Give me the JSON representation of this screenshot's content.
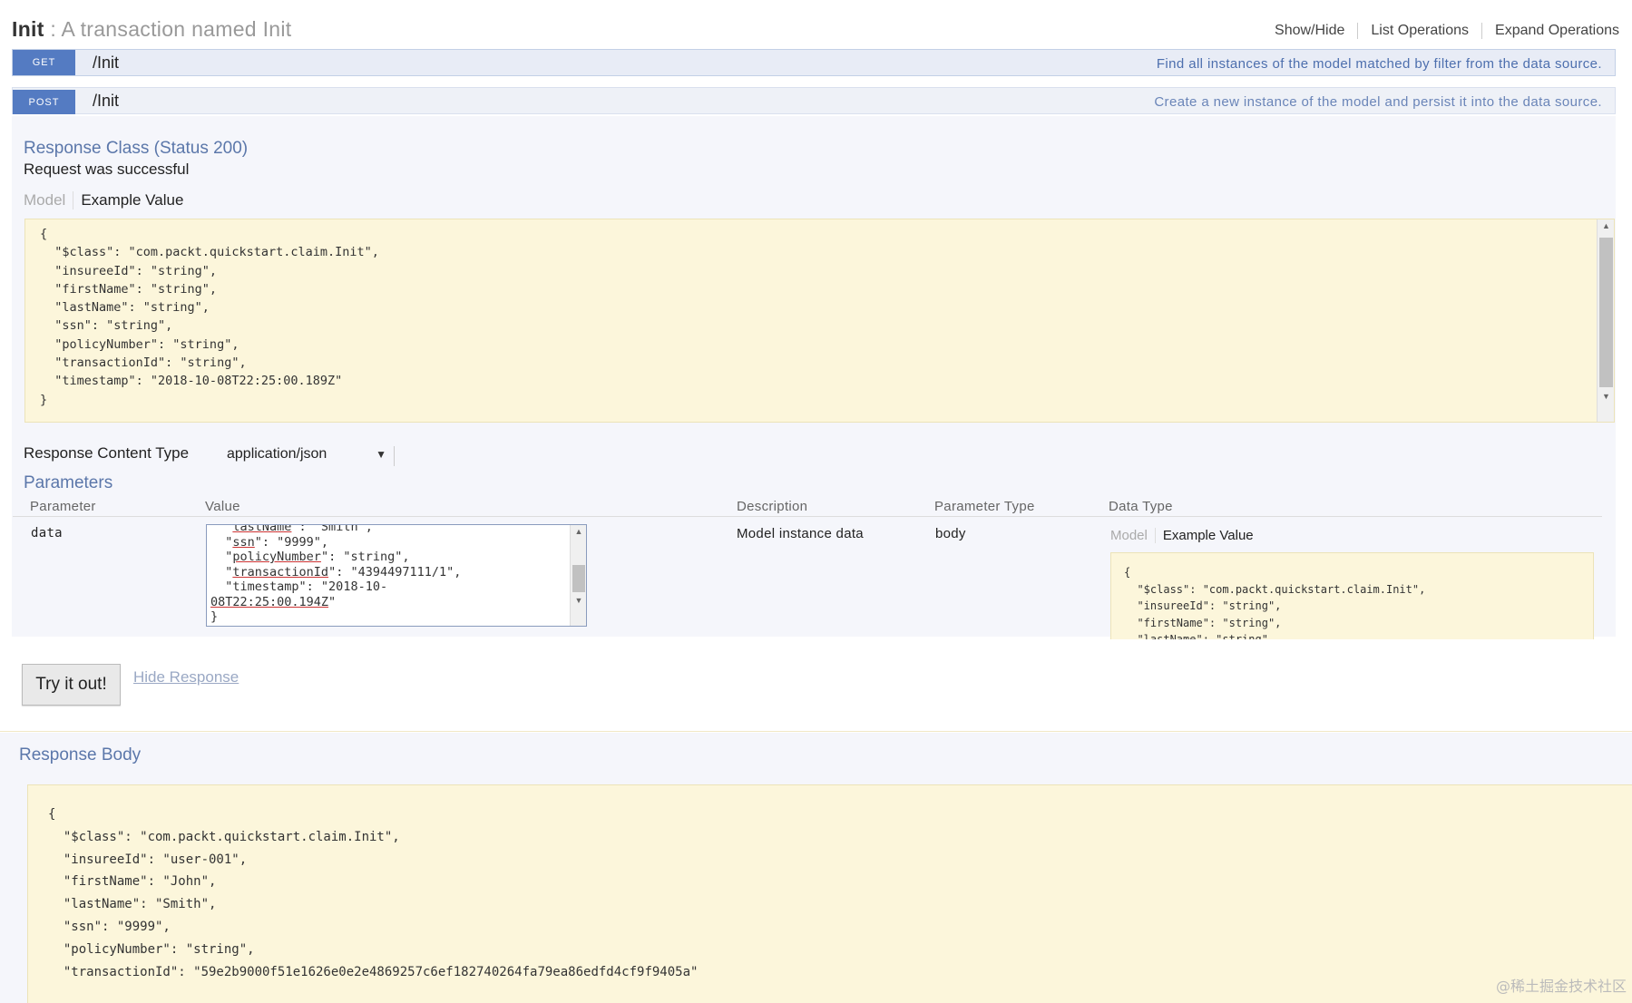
{
  "header": {
    "resource_name": "Init",
    "resource_description": " : A transaction named Init",
    "links": [
      "Show/Hide",
      "List Operations",
      "Expand Operations"
    ]
  },
  "operations": [
    {
      "verb": "GET",
      "path": "/Init",
      "description": "Find all instances of the model matched by filter from the data source."
    },
    {
      "verb": "POST",
      "path": "/Init",
      "description": "Create a new instance of the model and persist it into the data source."
    }
  ],
  "response_class": {
    "title": "Response Class (Status 200)",
    "message": "Request was successful",
    "tab_model": "Model",
    "tab_example": "Example Value",
    "example_code": "{\n  \"$class\": \"com.packt.quickstart.claim.Init\",\n  \"insureeId\": \"string\",\n  \"firstName\": \"string\",\n  \"lastName\": \"string\",\n  \"ssn\": \"string\",\n  \"policyNumber\": \"string\",\n  \"transactionId\": \"string\",\n  \"timestamp\": \"2018-10-08T22:25:00.189Z\"\n}"
  },
  "response_content_type": {
    "label": "Response Content Type",
    "selected": "application/json"
  },
  "parameters": {
    "title": "Parameters",
    "headers": [
      "Parameter",
      "Value",
      "Description",
      "Parameter Type",
      "Data Type"
    ],
    "rows": [
      {
        "name": "data",
        "value_lines": [
          {
            "pre": "  \"",
            "key": "lastName",
            "post": "\": \"Smith\","
          },
          {
            "pre": "  \"",
            "key": "ssn",
            "post": "\": \"9999\","
          },
          {
            "pre": "  \"",
            "key": "policyNumber",
            "post": "\": \"string\","
          },
          {
            "pre": "  \"",
            "key": "transactionId",
            "post": "\": \"4394497111/1\","
          },
          {
            "pre": "  \"",
            "key": "timestamp",
            "post": "\": \"2018-10-"
          },
          {
            "pre": "",
            "key": "08T22:25:00.194Z",
            "post": "\""
          },
          {
            "pre": "}",
            "key": "",
            "post": ""
          }
        ],
        "description": "Model instance data",
        "parameter_type": "body",
        "data_type_tab_model": "Model",
        "data_type_tab_example": "Example Value",
        "data_type_code": "{\n  \"$class\": \"com.packt.quickstart.claim.Init\",\n  \"insureeId\": \"string\",\n  \"firstName\": \"string\",\n  \"lastName\": \"string\","
      }
    ]
  },
  "actions": {
    "try_button": "Try it out!",
    "hide_response": "Hide Response"
  },
  "response_body": {
    "title": "Response Body",
    "code": "{\n  \"$class\": \"com.packt.quickstart.claim.Init\",\n  \"insureeId\": \"user-001\",\n  \"firstName\": \"John\",\n  \"lastName\": \"Smith\",\n  \"ssn\": \"9999\",\n  \"policyNumber\": \"string\",\n  \"transactionId\": \"59e2b9000f51e1626e0e2e4869257c6ef182740264fa79ea86edfd4cf9f9405a\""
  },
  "watermark": "@稀土掘金技术社区"
}
